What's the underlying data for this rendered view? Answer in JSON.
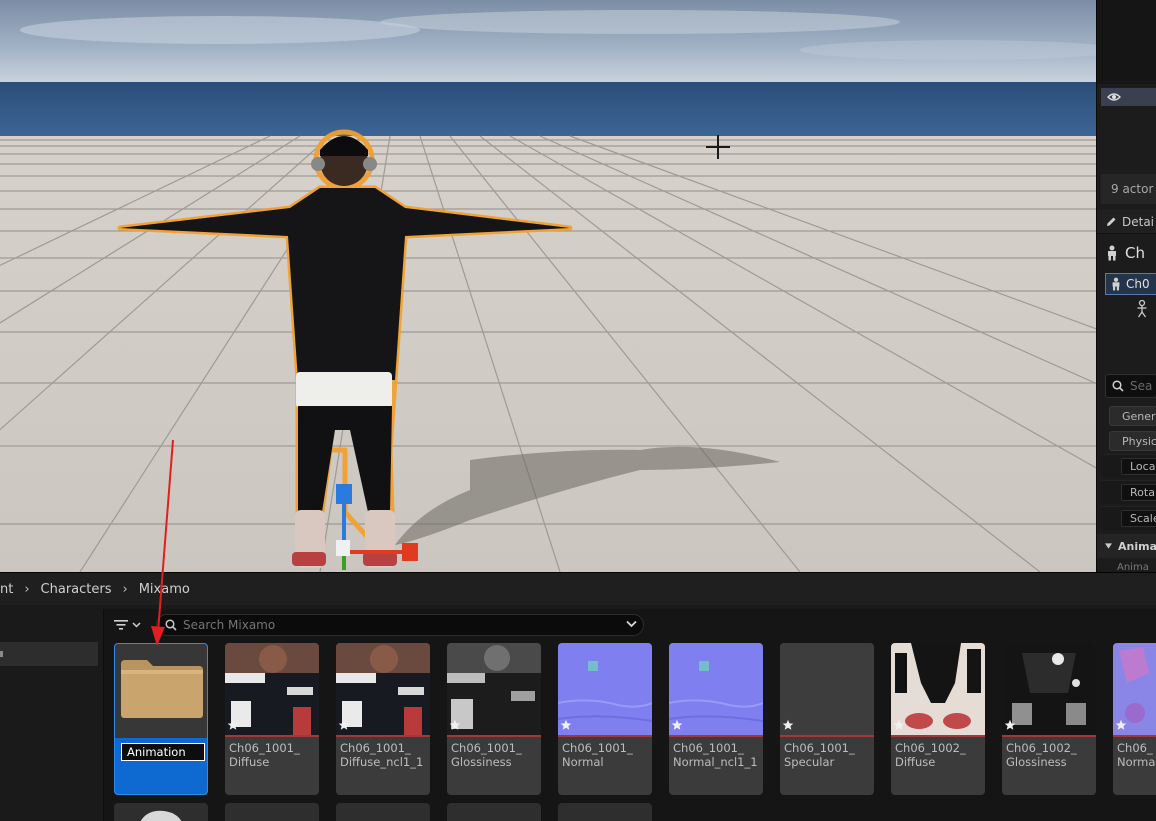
{
  "viewport": {
    "scene": "3d-viewport",
    "outline_color": "#f0a030",
    "gizmo_colors": {
      "x": "#e03a20",
      "y": "#3aa020",
      "z": "#2a7ae0"
    }
  },
  "right_panel": {
    "actor_count": "9 actor",
    "details_tab": "Detai",
    "selected_title": "Ch",
    "selected_component": "Ch0",
    "search_placeholder": "Sea",
    "filter_buttons": [
      "Gener",
      "Physic"
    ],
    "properties": [
      "Loca",
      "Rota",
      "Scale"
    ],
    "section_label": "Anima",
    "section_sub": "Anima"
  },
  "content_browser": {
    "breadcrumb": [
      "nt",
      "Characters",
      "Mixamo"
    ],
    "search_placeholder": "Search Mixamo",
    "accent_color": "#0e6ad0",
    "assets": [
      {
        "name": "Animation",
        "kind": "folder",
        "renaming": true
      },
      {
        "name": "Ch06_1001_\nDiffuse",
        "kind": "texture",
        "thumb": "diffuse"
      },
      {
        "name": "Ch06_1001_\nDiffuse_ncl1_1",
        "kind": "texture",
        "thumb": "diffuse"
      },
      {
        "name": "Ch06_1001_\nGlossiness",
        "kind": "texture",
        "thumb": "gloss"
      },
      {
        "name": "Ch06_1001_\nNormal",
        "kind": "texture",
        "thumb": "normal"
      },
      {
        "name": "Ch06_1001_\nNormal_ncl1_1",
        "kind": "texture",
        "thumb": "normal"
      },
      {
        "name": "Ch06_1001_\nSpecular",
        "kind": "texture",
        "thumb": "specular"
      },
      {
        "name": "Ch06_1002_\nDiffuse",
        "kind": "texture",
        "thumb": "diffuse2"
      },
      {
        "name": "Ch06_1002_\nGlossiness",
        "kind": "texture",
        "thumb": "gloss2"
      },
      {
        "name": "Ch06_\nNorma",
        "kind": "texture",
        "thumb": "normal2"
      }
    ]
  }
}
